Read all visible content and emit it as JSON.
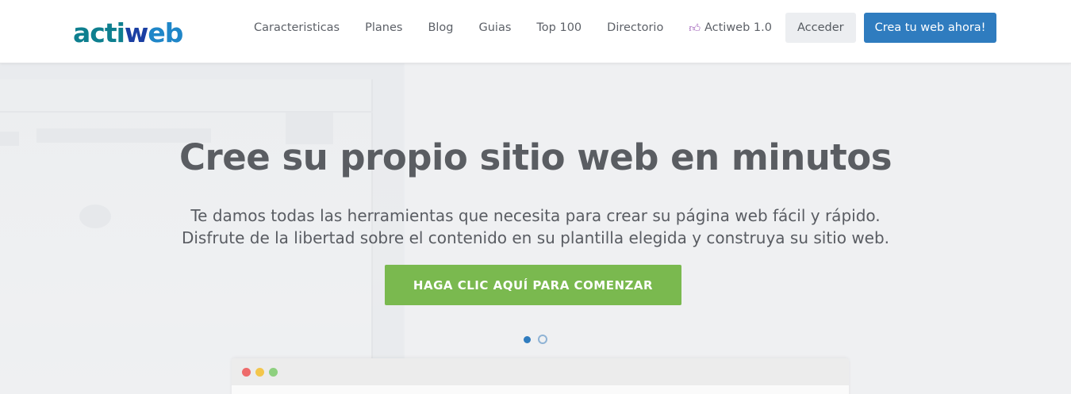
{
  "logo": {
    "text_part1": "acti",
    "text_part2": "w",
    "text_part3": "eb"
  },
  "nav": {
    "items": [
      {
        "label": "Caracteristicas"
      },
      {
        "label": "Planes"
      },
      {
        "label": "Blog"
      },
      {
        "label": "Guias"
      },
      {
        "label": "Top 100"
      },
      {
        "label": "Directorio"
      }
    ],
    "promo": {
      "label": "Actiweb 1.0",
      "icon": "thumbs-up-icon"
    },
    "login_label": "Acceder",
    "create_label": "Crea tu web ahora!"
  },
  "hero": {
    "title": "Cree su propio sitio web en minutos",
    "subtitle_line1": "Te damos todas las herramientas que necesita para crear su página web fácil y rápido.",
    "subtitle_line2": "Disfrute de la libertad sobre el contenido en su plantilla elegida y construya su sitio web.",
    "cta_label": "HAGA CLIC AQUÍ PARA COMENZAR"
  },
  "carousel": {
    "slides": 2,
    "active": 1
  },
  "colors": {
    "brand_blue": "#2f7cbf",
    "cta_green": "#7ab94f",
    "logo_teal": "#0e7f8f"
  }
}
